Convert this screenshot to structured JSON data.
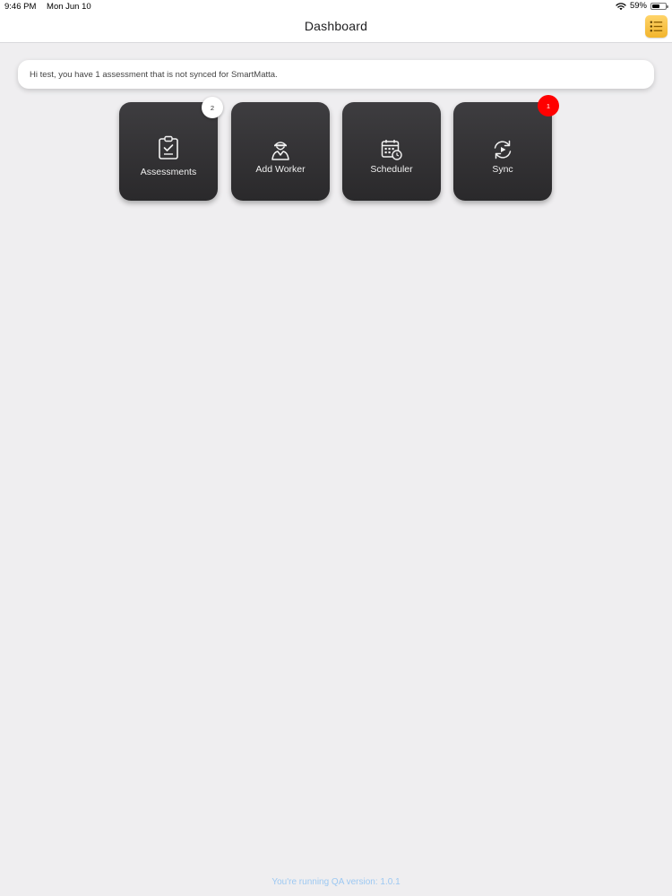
{
  "status_bar": {
    "time": "9:46 PM",
    "date": "Mon Jun 10",
    "battery": "59%",
    "wifi_icon": "wifi-icon",
    "battery_icon": "battery-icon",
    "battery_level": 0.59
  },
  "header": {
    "title": "Dashboard",
    "menu_icon": "list-menu-icon"
  },
  "notice": {
    "text": "Hi test, you have 1 assessment that is not synced for SmartMatta."
  },
  "tiles": [
    {
      "label": "Assessments",
      "icon": "clipboard-check-icon",
      "badge": "2",
      "badge_color": "#ffffff"
    },
    {
      "label": "Add Worker",
      "icon": "add-worker-icon",
      "badge": "",
      "badge_color": ""
    },
    {
      "label": "Scheduler",
      "icon": "calendar-clock-icon",
      "badge": "",
      "badge_color": ""
    },
    {
      "label": "Sync",
      "icon": "sync-icon",
      "badge": "1",
      "badge_color": "#ff0000"
    }
  ],
  "footer": {
    "version_text": "You're running QA version: 1.0.1"
  },
  "colors": {
    "background": "#efeef0",
    "tile": "#333235",
    "menu_icon": "#f2b52d",
    "footer_text": "#9cc8f2",
    "badge_red": "#ff0000"
  }
}
